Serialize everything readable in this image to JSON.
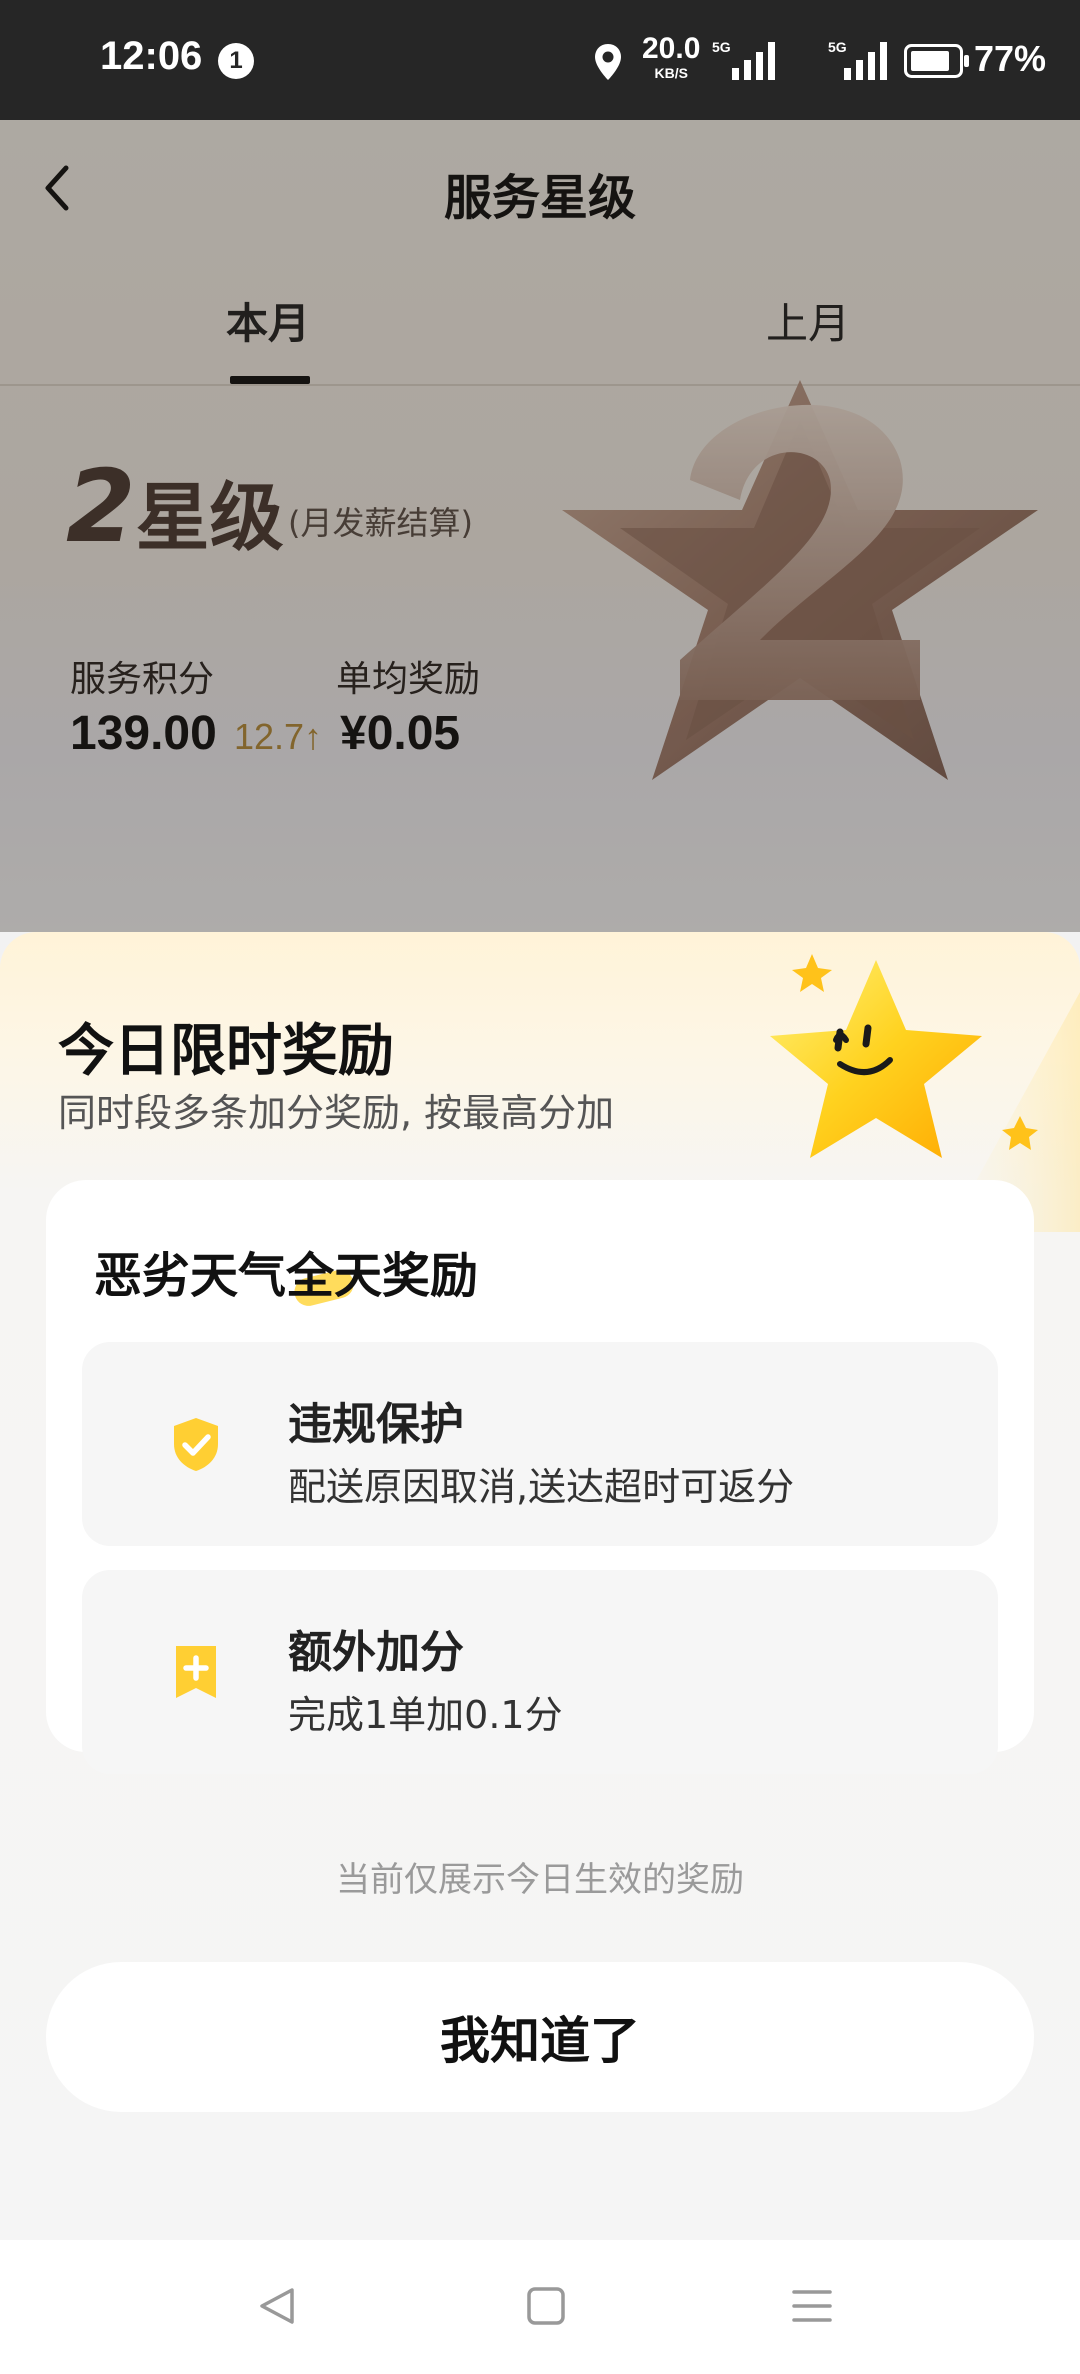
{
  "status_bar": {
    "time": "12:06",
    "notification_count": "1",
    "net_speed_value": "20.0",
    "net_speed_unit": "KB/S",
    "signal_1_label": "5G",
    "signal_2_label": "5G",
    "battery": "77%"
  },
  "header": {
    "title": "服务星级"
  },
  "tabs": [
    {
      "label": "本月",
      "selected": true
    },
    {
      "label": "上月",
      "selected": false
    }
  ],
  "level": {
    "number": "2",
    "text": "星级",
    "note": "(月发薪结算)"
  },
  "stats": {
    "score_label": "服务积分",
    "score_value": "139.00",
    "score_delta": "12.7↑",
    "avg_label": "单均奖励",
    "avg_value": "¥0.05"
  },
  "sheet": {
    "title": "今日限时奖励",
    "subtitle": "同时段多条加分奖励, 按最高分加",
    "card": {
      "title": "恶劣天气全天奖励",
      "benefits": [
        {
          "title": "违规保护",
          "desc": "配送原因取消,送达超时可返分",
          "icon": "shield-check-icon"
        },
        {
          "title": "额外加分",
          "desc": "完成1单加0.1分",
          "icon": "plus-bookmark-icon"
        }
      ]
    },
    "footer_note": "当前仅展示今日生效的奖励",
    "confirm_label": "我知道了"
  },
  "colors": {
    "accent_yellow": "#ffd23f",
    "delta_gold": "#b18a3a",
    "level_brown": "#4a3a33"
  }
}
